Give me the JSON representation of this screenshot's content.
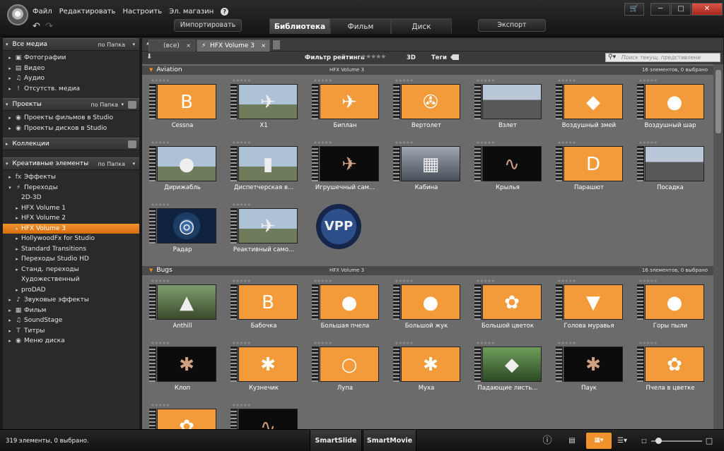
{
  "menu": [
    "Файл",
    "Редактировать",
    "Настроить",
    "Эл. магазин"
  ],
  "help_icon": "?",
  "top_buttons": {
    "import": "Импортировать",
    "export": "Экспорт"
  },
  "main_tabs": [
    "Библиотека",
    "Фильм",
    "Диск"
  ],
  "window_controls": {
    "cart": "🛒",
    "minimize": "─",
    "maximize": "□",
    "close": "✕"
  },
  "sidebar": {
    "all_media": {
      "title": "Все медиа",
      "sort": "по Папка",
      "items": [
        "Фотографии",
        "Видео",
        "Аудио",
        "Отсутств. медиа"
      ]
    },
    "projects": {
      "title": "Проекты",
      "sort": "по Папка",
      "items": [
        "Проекты фильмов в Studio",
        "Проекты дисков в Studio"
      ]
    },
    "collections": {
      "title": "Коллекции"
    },
    "creative": {
      "title": "Креативные элементы",
      "sort": "по Папка",
      "items": [
        {
          "label": "Эффекты",
          "level": 0,
          "arrow": "▸",
          "icon": "fx"
        },
        {
          "label": "Переходы",
          "level": 0,
          "arrow": "▾",
          "icon": "⚡"
        },
        {
          "label": "2D-3D",
          "level": 1,
          "arrow": "",
          "icon": ""
        },
        {
          "label": "HFX Volume 1",
          "level": 1,
          "arrow": "▸",
          "icon": ""
        },
        {
          "label": "HFX Volume 2",
          "level": 1,
          "arrow": "▸",
          "icon": ""
        },
        {
          "label": "HFX Volume 3",
          "level": 1,
          "arrow": "▸",
          "icon": "",
          "selected": true
        },
        {
          "label": "HollywoodFx for Studio",
          "level": 1,
          "arrow": "▸",
          "icon": ""
        },
        {
          "label": "Standard Transitions",
          "level": 1,
          "arrow": "▸",
          "icon": ""
        },
        {
          "label": "Переходы Studio HD",
          "level": 1,
          "arrow": "▸",
          "icon": ""
        },
        {
          "label": "Станд. переходы",
          "level": 1,
          "arrow": "▸",
          "icon": ""
        },
        {
          "label": "Художественный",
          "level": 1,
          "arrow": "",
          "icon": ""
        },
        {
          "label": "proDAD",
          "level": 1,
          "arrow": "▸",
          "icon": ""
        },
        {
          "label": "Звуковые эффекты",
          "level": 0,
          "arrow": "▸",
          "icon": "♪"
        },
        {
          "label": "Фильм",
          "level": 0,
          "arrow": "▸",
          "icon": "▦"
        },
        {
          "label": "SoundStage",
          "level": 0,
          "arrow": "▸",
          "icon": "♫"
        },
        {
          "label": "Титры",
          "level": 0,
          "arrow": "▸",
          "icon": "T"
        },
        {
          "label": "Меню диска",
          "level": 0,
          "arrow": "▸",
          "icon": "◉"
        }
      ]
    }
  },
  "browser_tabs": [
    {
      "label": "(все)",
      "close": "×"
    },
    {
      "label": "HFX Volume 3",
      "close": "×",
      "active": true
    }
  ],
  "filter_bar": {
    "rating_label": "Фильтр рейтинга",
    "rating_stars": "★★★★★",
    "three_d": "3D",
    "tags": "Теги",
    "search_placeholder": "Поиск текущ. представлени"
  },
  "tile_stars": "★★★★★",
  "groups": [
    {
      "title": "Aviation",
      "source": "HFX Volume 3",
      "count": "16 элементов, 0 выбрано",
      "items": [
        {
          "name": "Cessna",
          "style": "orange",
          "glyph": "B"
        },
        {
          "name": "X1",
          "style": "sky",
          "glyph": "✈"
        },
        {
          "name": "Биплан",
          "style": "orange",
          "glyph": "✈"
        },
        {
          "name": "Вертолет",
          "style": "orange",
          "glyph": "✇"
        },
        {
          "name": "Взлет",
          "style": "runway",
          "glyph": ""
        },
        {
          "name": "Воздушный змей",
          "style": "orange",
          "glyph": "◆"
        },
        {
          "name": "Воздушный шар",
          "style": "orange",
          "glyph": "●"
        },
        {
          "name": "Дирижабль",
          "style": "sky",
          "glyph": "●"
        },
        {
          "name": "Диспетчерская в...",
          "style": "sky",
          "glyph": "▮"
        },
        {
          "name": "Игрушечный сам...",
          "style": "black",
          "glyph": "✈"
        },
        {
          "name": "Кабина",
          "style": "cabin",
          "glyph": "▦"
        },
        {
          "name": "Крылья",
          "style": "black",
          "glyph": "∿"
        },
        {
          "name": "Парашют",
          "style": "orange",
          "glyph": "D"
        },
        {
          "name": "Посадка",
          "style": "runway",
          "glyph": ""
        },
        {
          "name": "Радар",
          "style": "radar",
          "glyph": "◎"
        },
        {
          "name": "Реактивный само...",
          "style": "sky",
          "glyph": "✈"
        },
        {
          "name": "",
          "style": "vpp",
          "glyph": "VPP"
        }
      ]
    },
    {
      "title": "Bugs",
      "source": "HFX Volume 3",
      "count": "16 элементов, 0 выбрано",
      "items": [
        {
          "name": "Anthill",
          "style": "nat",
          "glyph": "▲"
        },
        {
          "name": "Бабочка",
          "style": "orange",
          "glyph": "B"
        },
        {
          "name": "Большая пчела",
          "style": "orange",
          "glyph": "●"
        },
        {
          "name": "Большой жук",
          "style": "orange",
          "glyph": "●"
        },
        {
          "name": "Большой цветок",
          "style": "orange",
          "glyph": "✿"
        },
        {
          "name": "Голова муравья",
          "style": "orange",
          "glyph": "▼"
        },
        {
          "name": "Горы пыли",
          "style": "orange",
          "glyph": "●"
        },
        {
          "name": "Клоп",
          "style": "black",
          "glyph": "✱"
        },
        {
          "name": "Кузнечик",
          "style": "orange",
          "glyph": "✱"
        },
        {
          "name": "Лупа",
          "style": "orange",
          "glyph": "○"
        },
        {
          "name": "Муха",
          "style": "orange",
          "glyph": "✱"
        },
        {
          "name": "Падающие листь...",
          "style": "green",
          "glyph": "◆"
        },
        {
          "name": "Паук",
          "style": "black",
          "glyph": "✱"
        },
        {
          "name": "Пчела в цветке",
          "style": "orange",
          "glyph": "✿"
        },
        {
          "name": "",
          "style": "orange",
          "glyph": "✿"
        },
        {
          "name": "",
          "style": "black",
          "glyph": "∿"
        }
      ]
    }
  ],
  "status": {
    "text": "319 элементы, 0 выбрано.",
    "smartslide": "SmartSlide",
    "smartmovie": "SmartMovie",
    "info_icon": "ⓘ"
  },
  "zoom": {
    "value": 0.1
  }
}
